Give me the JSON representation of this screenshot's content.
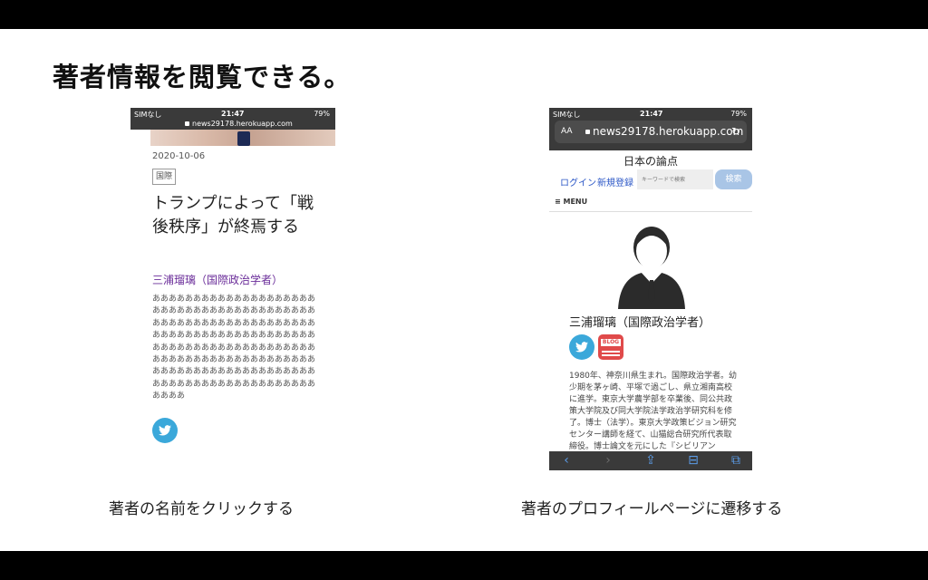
{
  "slide": {
    "title": "著者情報を閲覧できる。",
    "caption_left": "著者の名前をクリックする",
    "caption_right": "著者のプロフィールページに遷移する"
  },
  "left_phone": {
    "status": {
      "carrier": "SIMなし",
      "time": "21:47",
      "battery": "79%",
      "url": "news29178.herokuapp.com"
    },
    "article": {
      "date": "2020-10-06",
      "category": "国際",
      "title": "トランプによって「戦後秩序」が終焉する",
      "author": "三浦瑠璃（国際政治学者）",
      "body": "ああああああああああああああああああああああああああああああああああああああああああああああああああああああああああああああああああああああああああああああああああああああああああああああああああああああああああああああああああああああああああああああああああああああああああああああああああああああああああああああああああああ"
    },
    "icons": {
      "share": "twitter-icon"
    }
  },
  "right_phone": {
    "status": {
      "carrier": "SIMなし",
      "time": "21:47",
      "battery": "79%"
    },
    "browser": {
      "aa": "AA",
      "url": "news29178.herokuapp.com",
      "reload": "↻"
    },
    "site": {
      "name": "日本の論点",
      "login": "ログイン",
      "signup": "新規登録",
      "search_placeholder": "キーワードで検索",
      "search_button": "検索",
      "menu": "≡ MENU"
    },
    "profile": {
      "name": "三浦瑠璃（国際政治学者）",
      "blog_label": "BLOG",
      "bio": "1980年、神奈川県生まれ。国際政治学者。幼少期を茅ヶ崎、平塚で過ごし、県立湘南高校に進学。東京大学農学部を卒業後、同公共政策大学院及び同大学院法学政治学研究科を修了。博士（法学）。東京大学政策ビジョン研究センター講師を経て、山猫総合研究所代表取締役。博士論文を元にした『シビリアン"
    },
    "toolbar": [
      "‹",
      "›",
      "⇪",
      "⊟",
      "⧉"
    ]
  },
  "colors": {
    "link": "#2a56c6",
    "author": "#6a2c99",
    "twitter": "#3ba8da",
    "blog": "#e04a4a",
    "search": "#a9c5e6"
  }
}
